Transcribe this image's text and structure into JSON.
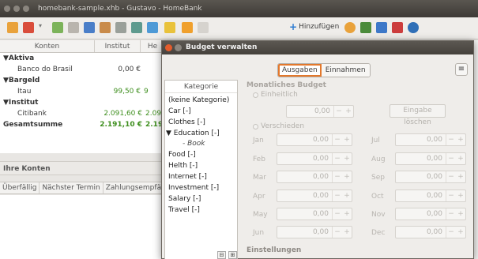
{
  "window": {
    "title": "homebank-sample.xhb - Gustavo - HomeBank"
  },
  "toolbar": {
    "add_label": "Hinzufügen"
  },
  "accounts": {
    "columns": [
      "Konten",
      "Institut",
      "He"
    ],
    "rows": [
      {
        "name": "▼Aktiva",
        "kind": "group"
      },
      {
        "name": "Banco do Brasil",
        "kind": "account",
        "v1": "0,00 €",
        "v2": ""
      },
      {
        "name": "▼Bargeld",
        "kind": "group"
      },
      {
        "name": "Itau",
        "kind": "account",
        "v1": "99,50 €",
        "v2": "9"
      },
      {
        "name": "▼Institut",
        "kind": "group"
      },
      {
        "name": "Citibank",
        "kind": "account",
        "v1": "2.091,60 €",
        "v2": "2.09"
      },
      {
        "name": "Gesamtsumme",
        "kind": "total",
        "v1": "2.191,10 €",
        "v2": "2.19"
      }
    ]
  },
  "my_accounts_label": "Ihre Konten",
  "schedule": {
    "columns": [
      "Überfällig",
      "Nächster Termin",
      "Zahlungsempfänge"
    ]
  },
  "dialog": {
    "title": "Budget verwalten",
    "tab_expenses": "Ausgaben",
    "tab_income": "Einnahmen",
    "menu_icon": "menu-icon",
    "category_header": "Kategorie",
    "categories": [
      {
        "label": "(keine Kategorie)",
        "sub": false
      },
      {
        "label": "Car [-]",
        "sub": false
      },
      {
        "label": "Clothes [-]",
        "sub": false
      },
      {
        "label": "▼ Education [-]",
        "sub": false
      },
      {
        "label": "- Book",
        "sub": true
      },
      {
        "label": "Food [-]",
        "sub": false
      },
      {
        "label": "Helth [-]",
        "sub": false
      },
      {
        "label": "Internet [-]",
        "sub": false
      },
      {
        "label": "Investment [-]",
        "sub": false
      },
      {
        "label": "Salary [-]",
        "sub": false
      },
      {
        "label": "Travel [-]",
        "sub": false
      }
    ],
    "monthly_budget_title": "Monatliches Budget",
    "radio_same": "Einheitlich",
    "same_value": "0,00",
    "clear_button": "Eingabe löschen",
    "radio_different": "Verschieden",
    "months_left": [
      {
        "name": "Jan",
        "value": "0,00"
      },
      {
        "name": "Feb",
        "value": "0,00"
      },
      {
        "name": "Mar",
        "value": "0,00"
      },
      {
        "name": "Apr",
        "value": "0,00"
      },
      {
        "name": "May",
        "value": "0,00"
      },
      {
        "name": "Jun",
        "value": "0,00"
      }
    ],
    "months_right": [
      {
        "name": "Jul",
        "value": "0,00"
      },
      {
        "name": "Aug",
        "value": "0,00"
      },
      {
        "name": "Sep",
        "value": "0,00"
      },
      {
        "name": "Oct",
        "value": "0,00"
      },
      {
        "name": "Nov",
        "value": "0,00"
      },
      {
        "name": "Dec",
        "value": "0,00"
      }
    ],
    "settings_title": "Einstellungen"
  }
}
